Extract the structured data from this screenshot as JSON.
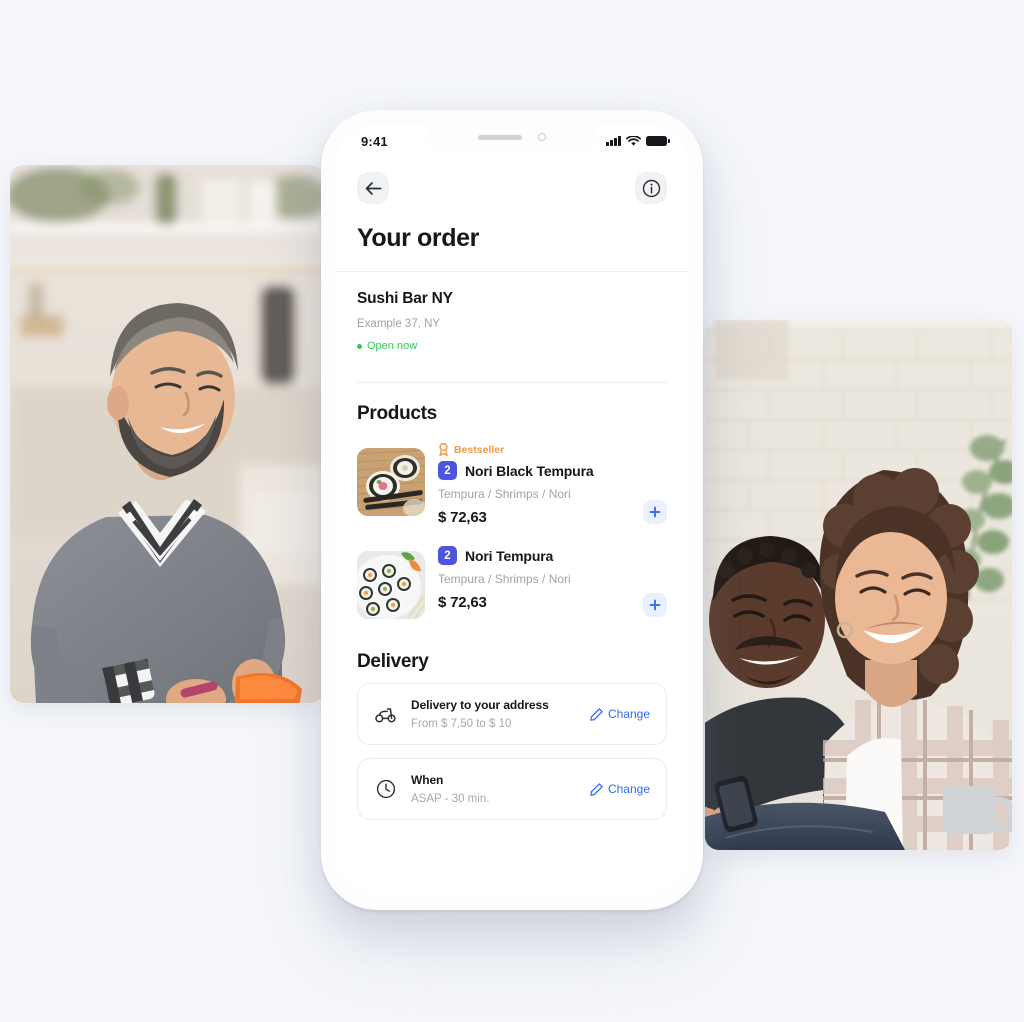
{
  "background_color": "#f5f7fb",
  "phone": {
    "status_bar": {
      "time": "9:41",
      "signal_icon": "cellular-signal-icon",
      "wifi_icon": "wifi-icon",
      "battery_icon": "battery-icon"
    },
    "nav": {
      "back_icon": "arrow-left-icon",
      "info_icon": "info-circle-icon"
    },
    "page_title": "Your order"
  },
  "restaurant": {
    "name": "Sushi Bar NY",
    "address": "Example 37, NY",
    "status": "Open now",
    "status_color": "#2ecb5b"
  },
  "products_section": {
    "heading": "Products",
    "items": [
      {
        "badge": "Bestseller",
        "badge_icon": "award-medal-icon",
        "badge_color": "#f2994a",
        "quantity": "2",
        "quantity_color": "#4c54e0",
        "name": "Nori Black Tempura",
        "description": "Tempura / Shrimps / Nori",
        "price": "$ 72,63",
        "thumbnail": "sushi-rolls-on-wooden-board",
        "add_icon": "plus-icon"
      },
      {
        "badge": "",
        "badge_icon": "",
        "badge_color": "#f2994a",
        "quantity": "2",
        "quantity_color": "#4c54e0",
        "name": "Nori Tempura",
        "description": "Tempura / Shrimps / Nori",
        "price": "$ 72,63",
        "thumbnail": "maki-rolls-on-white-plate",
        "add_icon": "plus-icon"
      }
    ]
  },
  "delivery_section": {
    "heading": "Delivery",
    "cards": [
      {
        "icon": "scooter-icon",
        "title": "Delivery to your address",
        "subtitle": "From $ 7,50 to $ 10",
        "action_label": "Change",
        "action_icon": "pencil-edit-icon",
        "action_color": "#2f6bff"
      },
      {
        "icon": "clock-icon",
        "title": "When",
        "subtitle": "ASAP - 30 min.",
        "action_label": "Change",
        "action_icon": "pencil-edit-icon",
        "action_color": "#2f6bff"
      }
    ]
  },
  "photos": [
    {
      "alt": "smiling-chef-holding-orange-box-in-kitchen",
      "position": "left"
    },
    {
      "alt": "smiling-couple-looking-at-phone-ordering-food",
      "position": "right"
    }
  ]
}
